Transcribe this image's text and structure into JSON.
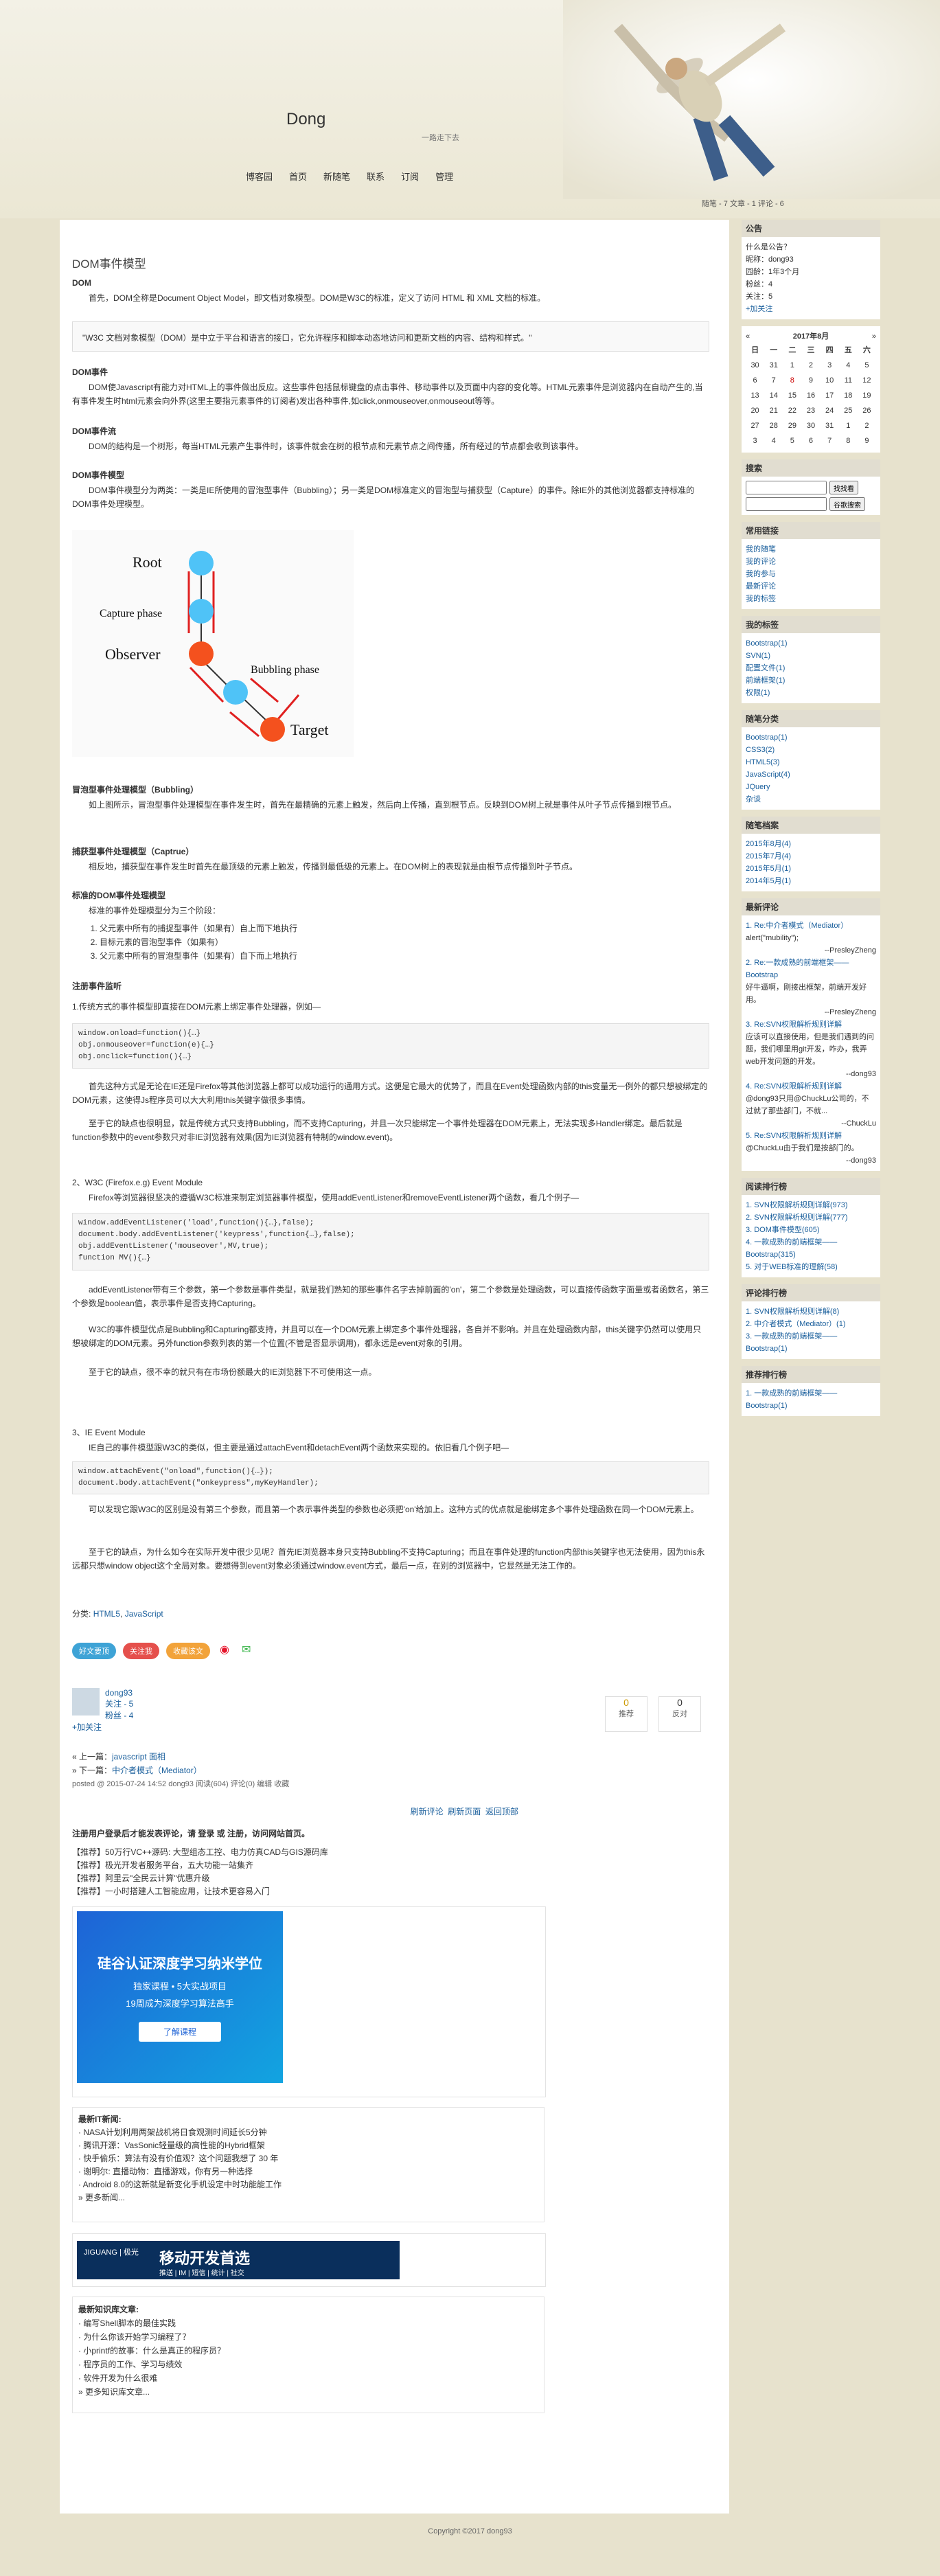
{
  "header": {
    "title": "Dong",
    "subtitle": "一路走下去",
    "nav": [
      "博客园",
      "首页",
      "新随笔",
      "联系",
      "订阅",
      "管理"
    ],
    "stats": "随笔 - 7  文章 - 1  评论 - 6"
  },
  "post": {
    "title": "DOM事件模型",
    "s_dom": "DOM",
    "dom_p": "首先，DOM全称是Document Object Model，即文档对象模型。DOM是W3C的标准，定义了访问 HTML 和 XML 文档的标准。",
    "quote": "\"W3C 文档对象模型（DOM）是中立于平台和语言的接口，它允许程序和脚本动态地访问和更新文档的内容、结构和样式。\"",
    "s_event": "DOM事件",
    "event_p": "DOM使Javascript有能力对HTML上的事件做出反应。这些事件包括鼠标键盘的点击事件、移动事件以及页面中内容的变化等。HTML元素事件是浏览器内在自动产生的,当有事件发生时html元素会向外界(这里主要指元素事件的订阅者)发出各种事件,如click,onmouseover,onmouseout等等。",
    "s_flow": "DOM事件流",
    "flow_p": "DOM的结构是一个树形，每当HTML元素产生事件时，该事件就会在树的根节点和元素节点之间传播，所有经过的节点都会收到该事件。",
    "s_model": "DOM事件模型",
    "model_p": "DOM事件模型分为两类：一类是IE所使用的冒泡型事件（Bubbling）；另一类是DOM标准定义的冒泡型与捕获型（Capture）的事件。除IE外的其他浏览器都支持标准的DOM事件处理模型。",
    "diagram": {
      "root": "Root",
      "capture": "Capture phase",
      "observer": "Observer",
      "bubbling": "Bubbling phase",
      "target": "Target"
    },
    "s_bubble": "冒泡型事件处理模型（Bubbling）",
    "bubble_p": "如上图所示，冒泡型事件处理模型在事件发生时，首先在最精确的元素上触发，然后向上传播，直到根节点。反映到DOM树上就是事件从叶子节点传播到根节点。",
    "s_capture": "捕获型事件处理模型（Captrue）",
    "capture_p": "相反地，捕获型在事件发生时首先在最顶级的元素上触发，传播到最低级的元素上。在DOM树上的表现就是由根节点传播到叶子节点。",
    "s_std": "标准的DOM事件处理模型",
    "std_p": "标准的事件处理模型分为三个阶段：",
    "std_list": [
      "父元素中所有的捕捉型事件（如果有）自上而下地执行",
      "目标元素的冒泡型事件（如果有）",
      "父元素中所有的冒泡型事件（如果有）自下而上地执行"
    ],
    "s_listen": "注册事件监听",
    "listen1": "1.传统方式的事件模型即直接在DOM元素上绑定事件处理器，例如—",
    "code1": [
      "window.onload=function(){…}",
      "obj.onmouseover=function(e){…}",
      "obj.onclick=function(){…}"
    ],
    "listen1_p1": "首先这种方式是无论在IE还是Firefox等其他浏览器上都可以成功运行的通用方式。这便是它最大的优势了，而且在Event处理函数内部的this变量无一例外的都只想被绑定的DOM元素，这使得Js程序员可以大大利用this关键字做很多事情。",
    "listen1_p2": "至于它的缺点也很明显，就是传统方式只支持Bubbling，而不支持Capturing，并且一次只能绑定一个事件处理器在DOM元素上，无法实现多Handler绑定。最后就是function参数中的event参数只对非IE浏览器有效果(因为IE浏览器有特制的window.event)。",
    "listen2": "2、W3C (Firefox.e.g) Event Module",
    "listen2_p": "Firefox等浏览器很坚决的遵循W3C标准来制定浏览器事件模型，使用addEventListener和removeEventListener两个函数，看几个例子—",
    "code2": [
      "window.addEventListener('load',function(){…},false);",
      "document.body.addEventListener('keypress',function{…},false);",
      "obj.addEventListener('mouseover',MV,true);",
      "function MV(){…}"
    ],
    "listen2_p1": "addEventListener带有三个参数，第一个参数是事件类型，就是我们熟知的那些事件名字去掉前面的'on'，第二个参数是处理函数，可以直接传函数字面量或者函数名，第三个参数是boolean值，表示事件是否支持Capturing。",
    "listen2_p2": "W3C的事件模型优点是Bubbling和Capturing都支持，并且可以在一个DOM元素上绑定多个事件处理器，各自并不影响。并且在处理函数内部，this关键字仍然可以使用只想被绑定的DOM元素。另外function参数列表的第一个位置(不管是否显示调用)，都永远是event对象的引用。",
    "listen2_p3": "至于它的缺点，很不幸的就只有在市场份额最大的IE浏览器下不可使用这一点。",
    "listen3": "3、IE Event Module",
    "listen3_p": "IE自己的事件模型跟W3C的类似，但主要是通过attachEvent和detachEvent两个函数来实现的。依旧看几个例子吧—",
    "code3": [
      "window.attachEvent(\"onload\",function(){…});",
      "document.body.attachEvent(\"onkeypress\",myKeyHandler);"
    ],
    "listen3_p1": "可以发现它跟W3C的区别是没有第三个参数，而且第一个表示事件类型的参数也必须把'on'给加上。这种方式的优点就是能绑定多个事件处理函数在同一个DOM元素上。",
    "listen3_p2": "至于它的缺点，为什么如今在实际开发中很少见呢？首先IE浏览器本身只支持Bubbling不支持Capturing；而且在事件处理的function内部this关键字也无法使用，因为this永远都只想window object这个全局对象。要想得到event对象必须通过window.event方式，最后一点，在别的浏览器中，它显然是无法工作的。",
    "category_label": "分类:",
    "categories": [
      "HTML5",
      "JavaScript"
    ]
  },
  "share": {
    "good": "好文要顶",
    "follow": "关注我",
    "fav": "收藏该文"
  },
  "author": {
    "name": "dong93",
    "follow": "关注 - 5",
    "fans": "粉丝 - 4",
    "add": "+加关注"
  },
  "votes": {
    "up_count": "0",
    "up_label": "推荐",
    "down_count": "0",
    "down_label": "反对"
  },
  "postnav": {
    "prev": "« 上一篇：",
    "prev_link": "javascript 面相",
    "next": "» 下一篇：",
    "next_link": "中介者模式（Mediator）",
    "meta": "posted @ 2015-07-24 14:52 dong93 阅读(604) 评论(0) 编辑 收藏"
  },
  "comment_links": [
    "刷新评论",
    "刷新页面",
    "返回顶部"
  ],
  "login_notice": "注册用户登录后才能发表评论，请 登录 或 注册，访问网站首页。",
  "recommend": [
    "【推荐】50万行VC++源码: 大型组态工控、电力仿真CAD与GIS源码库",
    "【推荐】极光开发者服务平台，五大功能一站集齐",
    "【推荐】阿里云\"全民云计算\"优惠升级",
    "【推荐】一小时搭建人工智能应用，让技术更容易入门"
  ],
  "ad1": {
    "title": "硅谷认证深度学习纳米学位",
    "line1": "独家课程 • 5大实战项目",
    "line2": "19周成为深度学习算法高手",
    "btn": "了解课程"
  },
  "news": {
    "title": "最新IT新闻:",
    "items": [
      "· NASA计划利用两架战机将日食观测时间延长5分钟",
      "· 腾讯开源：VasSonic轻量级的高性能的Hybrid框架",
      "· 快手偷乐：算法有没有价值观？这个问题我想了 30 年",
      "· 谢明尔: 直播动物：直播游戏，你有另一种选择",
      "· Android 8.0的这新就是新变化手机设定中时功能能工作"
    ],
    "more": "» 更多新闻..."
  },
  "ad2": {
    "brand": "JIGUANG | 极光",
    "text": "移动开发首选",
    "sub": "推送 | IM | 短信 | 统计 | 社交"
  },
  "kb": {
    "title": "最新知识库文章:",
    "items": [
      "· 编写Shell脚本的最佳实践",
      "· 为什么你该开始学习编程了？",
      "· 小printf的故事：什么是真正的程序员？",
      "· 程序员的工作、学习与绩效",
      "· 软件开发为什么很难"
    ],
    "more": "» 更多知识库文章..."
  },
  "sidebar": {
    "notice_title": "公告",
    "notice": [
      "什么是公告？",
      "昵称：dong93",
      "园龄：1年3个月",
      "粉丝：4",
      "关注：5",
      "+加关注"
    ],
    "calendar_title": "2017年8月",
    "weekdays": [
      "日",
      "一",
      "二",
      "三",
      "四",
      "五",
      "六"
    ],
    "weeks": [
      [
        "30",
        "31",
        "1",
        "2",
        "3",
        "4",
        "5"
      ],
      [
        "6",
        "7",
        "8",
        "9",
        "10",
        "11",
        "12"
      ],
      [
        "13",
        "14",
        "15",
        "16",
        "17",
        "18",
        "19"
      ],
      [
        "20",
        "21",
        "22",
        "23",
        "24",
        "25",
        "26"
      ],
      [
        "27",
        "28",
        "29",
        "30",
        "31",
        "1",
        "2"
      ],
      [
        "3",
        "4",
        "5",
        "6",
        "7",
        "8",
        "9"
      ]
    ],
    "search_title": "搜索",
    "search_btn1": "找找看",
    "search_btn2": "谷歌搜索",
    "links_title": "常用链接",
    "links": [
      "我的随笔",
      "我的评论",
      "我的参与",
      "最新评论",
      "我的标签"
    ],
    "tags_title": "我的标签",
    "tags": [
      "Bootstrap(1)",
      "SVN(1)",
      "配置文件(1)",
      "前端框架(1)",
      "权限(1)"
    ],
    "cats_title": "随笔分类",
    "cats": [
      "Bootstrap(1)",
      "CSS3(2)",
      "HTML5(3)",
      "JavaScript(4)",
      "JQuery",
      "杂谈"
    ],
    "archive_title": "随笔档案",
    "archive": [
      "2015年8月(4)",
      "2015年7月(4)",
      "2015年5月(1)",
      "2014年5月(1)"
    ],
    "comments_title": "最新评论",
    "comments": [
      "1. Re:中介者模式（Mediator）",
      "alert(\"mubility\");",
      "--PresleyZheng",
      "2. Re:一款成熟的前端框架——Bootstrap",
      "好牛逼啊，刚接出框架，前端开发好用。",
      "--PresleyZheng",
      "3. Re:SVN权限解析规则详解",
      "应该可以直接使用，但是我们遇到的问题，我们哪里用git开发，咋办，我弄web开发问题的开发。",
      "--dong93",
      "4. Re:SVN权限解析规则详解",
      "@dong93只用@ChuckLu公司的，不过就了那些部门，不就...",
      "--ChuckLu",
      "5. Re:SVN权限解析规则详解",
      "@ChuckLu由于我们是按部门的。",
      "--dong93"
    ],
    "read_title": "阅读排行榜",
    "read": [
      "1. SVN权限解析规则详解(973)",
      "2. SVN权限解析规则详解(777)",
      "3. DOM事件模型(605)",
      "4. 一款成熟的前端框架——Bootstrap(315)",
      "5. 对于WEB标准的理解(58)"
    ],
    "comment_rank_title": "评论排行榜",
    "comment_rank": [
      "1. SVN权限解析规则详解(8)",
      "2. 中介者模式（Mediator）(1)",
      "3. 一款成熟的前端框架——Bootstrap(1)"
    ],
    "top_title": "推荐排行榜",
    "top": [
      "1. 一款成熟的前端框架——Bootstrap(1)"
    ]
  },
  "footer": "Copyright ©2017 dong93"
}
